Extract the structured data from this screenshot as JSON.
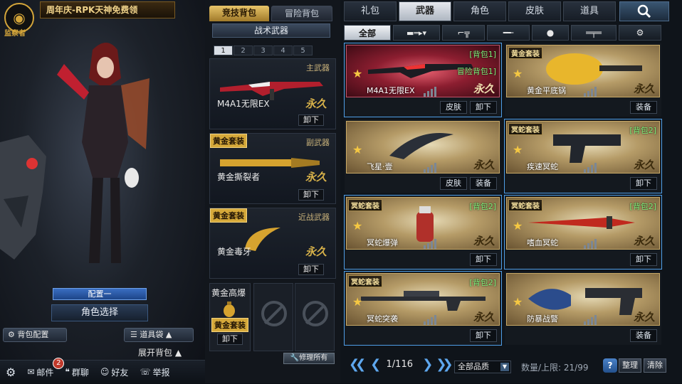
{
  "header": {
    "promo": "周年庆-RPK天神免费领",
    "logo_text": "监察者"
  },
  "left": {
    "loadout": "配置一",
    "char_select": "角色选择",
    "bag_config": "背包配置",
    "item_bag": "道具袋",
    "expand": "展开背包"
  },
  "bottom": {
    "mail": "邮件",
    "mail_count": "2",
    "group": "群聊",
    "friends": "好友",
    "report": "举报"
  },
  "middle": {
    "tabs": [
      "竞技背包",
      "冒险背包"
    ],
    "tactical": "战术武器",
    "slots": [
      "1",
      "2",
      "3",
      "4",
      "5"
    ],
    "primary": {
      "cat": "主武器",
      "name": "M4A1无限EX",
      "perm": "永久",
      "btn": "卸下"
    },
    "secondary": {
      "cat": "副武器",
      "tag": "黄金套装",
      "name": "黄金撕裂者",
      "perm": "永久",
      "btn": "卸下"
    },
    "melee": {
      "cat": "近战武器",
      "tag": "黄金套装",
      "name": "黄金毒牙",
      "perm": "永久",
      "btn": "卸下"
    },
    "grenade": {
      "name": "黄金高爆",
      "tag": "黄金套装",
      "btn": "卸下"
    },
    "repair": "修理所有"
  },
  "right": {
    "tabs": [
      "礼包",
      "武器",
      "角色",
      "皮肤",
      "道具"
    ],
    "filter_all": "全部",
    "items": [
      {
        "name": "M4A1无限EX",
        "tag": "",
        "bag1": "[背包1]",
        "bag2": "冒险背包1]",
        "perm": "永久",
        "btns": [
          "皮肤",
          "卸下"
        ]
      },
      {
        "name": "黄金平底锅",
        "tag": "黄金套装",
        "bag1": "",
        "bag2": "",
        "perm": "永久",
        "btns": [
          "装备"
        ]
      },
      {
        "name": "飞星·壹",
        "tag": "",
        "bag1": "",
        "bag2": "",
        "perm": "永久",
        "btns": [
          "皮肤",
          "装备"
        ]
      },
      {
        "name": "疾速冥蛇",
        "tag": "冥蛇套装",
        "bag1": "[背包2]",
        "bag2": "",
        "perm": "永久",
        "btns": [
          "卸下"
        ]
      },
      {
        "name": "冥蛇爆弹",
        "tag": "冥蛇套装",
        "bag1": "[背包2]",
        "bag2": "",
        "perm": "永久",
        "btns": [
          "卸下"
        ]
      },
      {
        "name": "嗜血冥蛇",
        "tag": "冥蛇套装",
        "bag1": "[背包2]",
        "bag2": "",
        "perm": "永久",
        "btns": [
          "卸下"
        ]
      },
      {
        "name": "冥蛇突袭",
        "tag": "冥蛇套装",
        "bag1": "[背包2]",
        "bag2": "",
        "perm": "永久",
        "btns": [
          "卸下"
        ]
      },
      {
        "name": "防暴战警",
        "tag": "",
        "bag1": "",
        "bag2": "",
        "perm": "永久",
        "btns": [
          "装备"
        ]
      }
    ],
    "page": "1/116",
    "quality": "全部品质",
    "capacity": "数量/上限: 21/99",
    "help": "?",
    "sort": "整理",
    "clear": "清除"
  }
}
